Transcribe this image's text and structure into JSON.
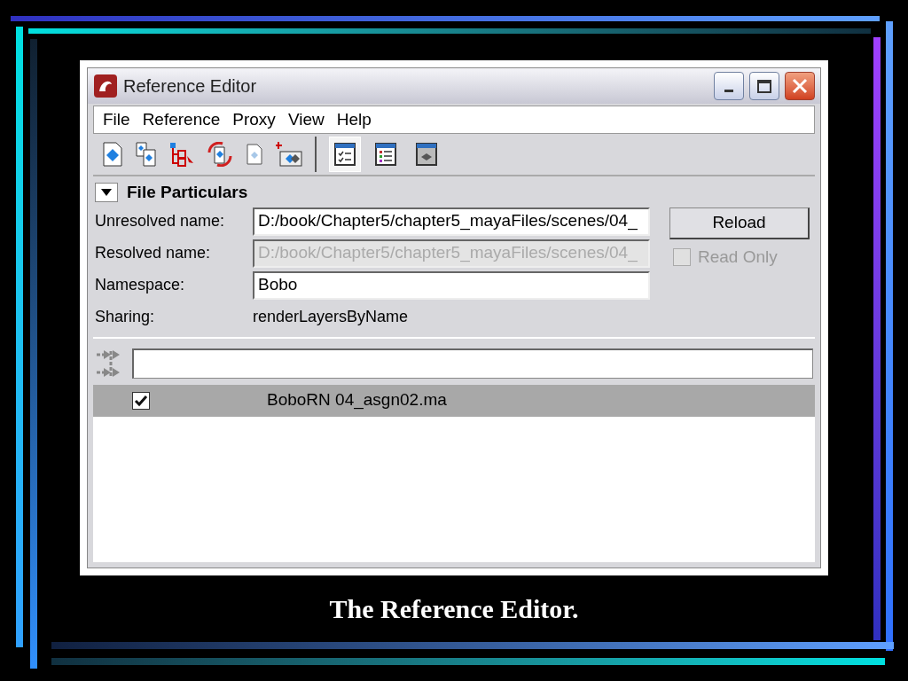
{
  "window": {
    "title": "Reference Editor"
  },
  "menu": [
    "File",
    "Reference",
    "Proxy",
    "View",
    "Help"
  ],
  "view_buttons": [
    {
      "selected": true
    },
    {
      "selected": false
    },
    {
      "selected": false
    }
  ],
  "file_particulars": {
    "title": "File Particulars",
    "expanded": true,
    "fields": [
      {
        "kind": "input",
        "label": "Unresolved name:",
        "value": "D:/book/Chapter5/chapter5_mayaFiles/scenes/04_",
        "disabled": false
      },
      {
        "kind": "input",
        "label": "Resolved name:",
        "value": "D:/book/Chapter5/chapter5_mayaFiles/scenes/04_",
        "disabled": true
      },
      {
        "kind": "input",
        "label": "Namespace:",
        "value": "Bobo",
        "disabled": false
      },
      {
        "kind": "text",
        "label": "Sharing:",
        "value": "renderLayersByName"
      }
    ],
    "reload_button": "Reload",
    "read_only": {
      "label": "Read Only",
      "checked": false,
      "disabled": true
    }
  },
  "references": [
    {
      "name": "BoboRN 04_asgn02.ma",
      "checked": true,
      "selected": true
    }
  ],
  "caption": "The Reference Editor."
}
